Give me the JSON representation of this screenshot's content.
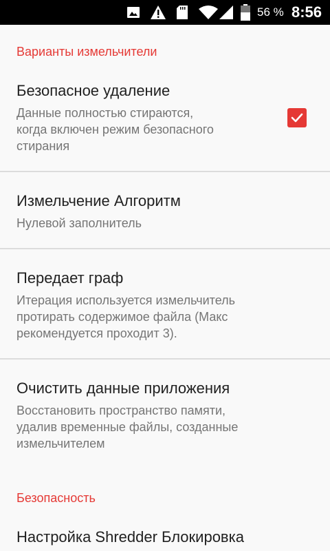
{
  "status_bar": {
    "battery_percent": "56 %",
    "time": "8:56",
    "icons": [
      "image-icon",
      "warning-icon",
      "sd-card-icon",
      "wifi-icon",
      "signal-icon",
      "battery-icon"
    ]
  },
  "sections": {
    "shredder_options": {
      "header": "Варианты измельчители",
      "secure_delete": {
        "title": "Безопасное удаление",
        "summary_line1": "Данные полностью стираются,",
        "summary_line2": "когда включен режим безопасного",
        "summary_line3": "стирания",
        "checked": true
      },
      "algorithm": {
        "title": "Измельчение Алгоритм",
        "summary": "Нулевой заполнитель"
      },
      "passes": {
        "title": "Передает граф",
        "summary_line1": "Итерация используется измельчитель",
        "summary_line2": "протирать содержимое файла (Макс",
        "summary_line3": "рекомендуется проходит 3)."
      },
      "clear_data": {
        "title": "Очистить данные приложения",
        "summary_line1": "Восстановить пространство памяти,",
        "summary_line2": "удалив временные файлы, созданные",
        "summary_line3": "измельчителем"
      }
    },
    "security": {
      "header": "Безопасность",
      "lock_setup": {
        "title": "Настройка Shredder Блокировка"
      }
    }
  },
  "colors": {
    "accent": "#e53935",
    "title_text": "#212121",
    "summary_text": "#757575",
    "background": "#f9f9f9",
    "status_bar": "#000000"
  }
}
